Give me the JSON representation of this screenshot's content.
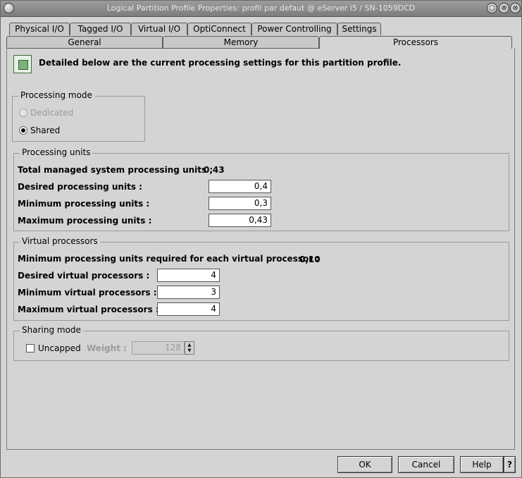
{
  "window": {
    "title": "Logical Partition Profile Properties: profil par defaut @ eServer i5 / SN-1059DCD",
    "controls": [
      "○",
      "⊗",
      "⊗"
    ]
  },
  "tabs_row1": [
    "Physical I/O",
    "Tagged I/O",
    "Virtual I/O",
    "OptiConnect",
    "Power Controlling",
    "Settings"
  ],
  "tabs_row2": [
    "General",
    "Memory",
    "Processors"
  ],
  "selected_tab": "Processors",
  "header": {
    "text": "Detailed below are the current processing settings for this partition profile."
  },
  "processing_mode": {
    "title": "Processing mode",
    "dedicated": "Dedicated",
    "shared": "Shared",
    "selected": "Shared"
  },
  "processing_units": {
    "title": "Processing units",
    "total_label": "Total managed system processing units :",
    "total_value": "0,43",
    "desired_label": "Desired processing units :",
    "desired_value": "0,4",
    "minimum_label": "Minimum processing units :",
    "minimum_value": "0,3",
    "maximum_label": "Maximum processing units :",
    "maximum_value": "0,43"
  },
  "virtual_processors": {
    "title": "Virtual processors",
    "min_required_label": "Minimum processing units required for each virtual processor :",
    "min_required_value": "0,10",
    "desired_label": "Desired virtual processors :",
    "desired_value": "4",
    "minimum_label": "Minimum virtual processors :",
    "minimum_value": "3",
    "maximum_label": "Maximum virtual processors :",
    "maximum_value": "4"
  },
  "sharing_mode": {
    "title": "Sharing mode",
    "uncapped_label": "Uncapped",
    "weight_label": "Weight :",
    "weight_value": "128",
    "spin_up": "▲",
    "spin_down": "▼"
  },
  "buttons": {
    "ok": "OK",
    "cancel": "Cancel",
    "help": "Help",
    "context_help": "?"
  }
}
